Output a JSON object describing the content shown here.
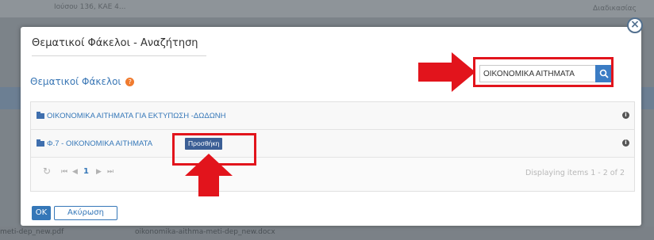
{
  "background": {
    "top_left_text": "Ιούσου 136, ΚΑΕ 4...",
    "top_right_text": "Διαδικασίας",
    "bottom_file_1": "meti-dep_new.pdf",
    "bottom_file_2": "oikonomika-aithma-meti-dep_new.docx"
  },
  "dialog": {
    "title": "Θεματικοί Φάκελοι - Αναζήτηση",
    "section_label": "Θεματικοί Φάκελοι",
    "section_badge": "?",
    "close_glyph": "×"
  },
  "search": {
    "value": "ΟΙΚΟΝΟΜΙΚΑ ΑΙΤΗΜΑΤΑ",
    "placeholder": ""
  },
  "grid": {
    "rows": [
      {
        "label": "ΟΙΚΟΝΟΜΙΚΑ ΑΙΤΗΜΑΤΑ ΓΙΑ ΕΚΤΥΠΩΣΗ -ΔΩΔΩΝΗ",
        "info": "i"
      },
      {
        "label": "Φ.7 - ΟΙΚΟΝΟΜΙΚΑ ΑΙΤΗΜΑΤΑ",
        "info": "i",
        "action": "Προσθήκη"
      }
    ]
  },
  "pager": {
    "refresh": "↻",
    "first": "⏮",
    "prev": "◀",
    "current": "1",
    "next": "▶",
    "last": "⏭",
    "display_text": "Displaying items 1 - 2 of 2"
  },
  "footer": {
    "ok_label": "OK",
    "cancel_label": "Ακύρωση"
  },
  "colors": {
    "accent": "#3577b8",
    "highlight": "#e2141c",
    "badge": "#f07b2f"
  }
}
